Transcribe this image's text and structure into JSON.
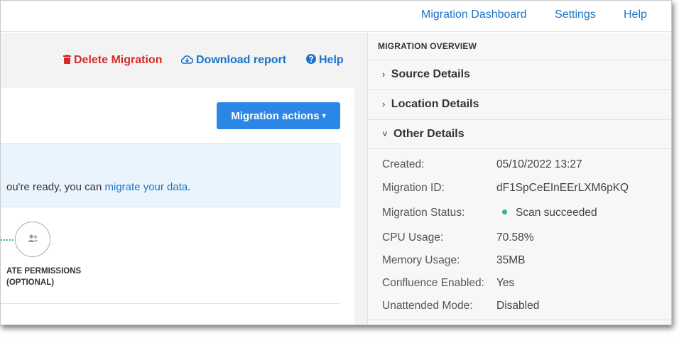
{
  "nav": {
    "dashboard": "Migration Dashboard",
    "settings": "Settings",
    "help": "Help"
  },
  "toolbar": {
    "delete_label": "Delete Migration",
    "download_label": "Download report",
    "help_label": "Help"
  },
  "main": {
    "actions_button": "Migration actions",
    "info_prefix": "ou're ready, you can ",
    "info_link": "migrate your data",
    "info_suffix": ".",
    "step_label_line1": "ATE PERMISSIONS",
    "step_label_line2": "(OPTIONAL)"
  },
  "overview": {
    "title": "MIGRATION OVERVIEW",
    "sections": [
      "Source Details",
      "Location Details",
      "Other Details"
    ],
    "details": [
      {
        "label": "Created:",
        "value": "05/10/2022 13:27"
      },
      {
        "label": "Migration ID:",
        "value": "dF1SpCeEInEErLXM6pKQ"
      },
      {
        "label": "Migration Status:",
        "value": "Scan succeeded"
      },
      {
        "label": "CPU Usage:",
        "value": "70.58%"
      },
      {
        "label": "Memory Usage:",
        "value": "35MB"
      },
      {
        "label": "Confluence Enabled:",
        "value": "Yes"
      },
      {
        "label": "Unattended Mode:",
        "value": "Disabled"
      }
    ]
  },
  "colors": {
    "link": "#1a73c9",
    "danger": "#d62a2a",
    "primary_button": "#2b87e6",
    "status_success": "#2bb39a"
  }
}
